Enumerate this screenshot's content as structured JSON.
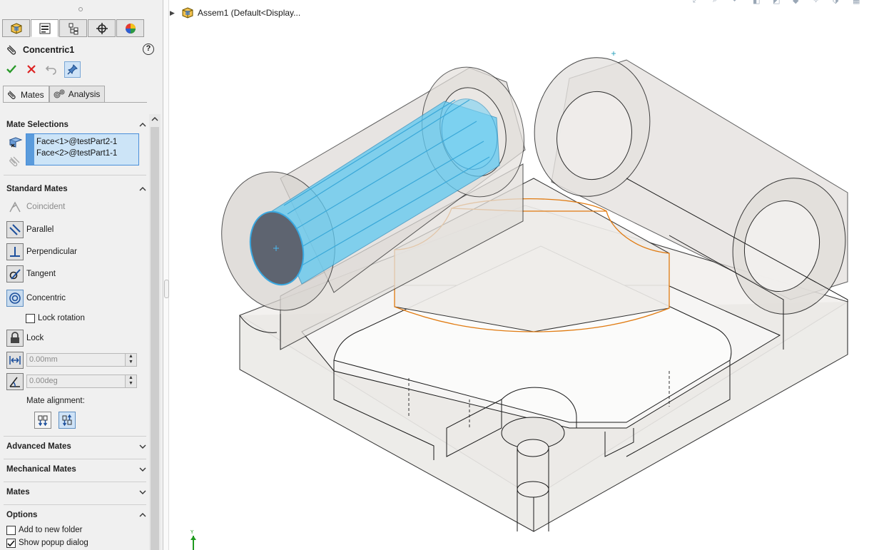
{
  "property_manager": {
    "title": "Concentric1",
    "help": "?",
    "subtabs": [
      {
        "label": "Mates"
      },
      {
        "label": "Analysis"
      }
    ],
    "groups": {
      "mate_selections": "Mate Selections",
      "standard_mates": "Standard Mates",
      "advanced_mates": "Advanced Mates",
      "mechanical_mates": "Mechanical Mates",
      "mates": "Mates",
      "options": "Options"
    },
    "selections": [
      "Face<1>@testPart2-1",
      "Face<2>@testPart1-1"
    ],
    "standard_mates": [
      {
        "label": "Coincident"
      },
      {
        "label": "Parallel"
      },
      {
        "label": "Perpendicular"
      },
      {
        "label": "Tangent"
      },
      {
        "label": "Concentric"
      }
    ],
    "lock_rotation": "Lock rotation",
    "lock": "Lock",
    "distance_value": "0.00mm",
    "angle_value": "0.00deg",
    "mate_alignment": "Mate alignment:",
    "options": {
      "add_to_new_folder": "Add to new folder",
      "show_popup_dialog": "Show popup dialog"
    }
  },
  "tree": {
    "root_label": "Assem1  (Default<Display..."
  },
  "triad": {
    "y_label": "Y"
  },
  "colors": {
    "selection_blue": "#5ec8f0",
    "highlight_orange": "#e07a10",
    "model_gray": "#d9d5d1"
  }
}
